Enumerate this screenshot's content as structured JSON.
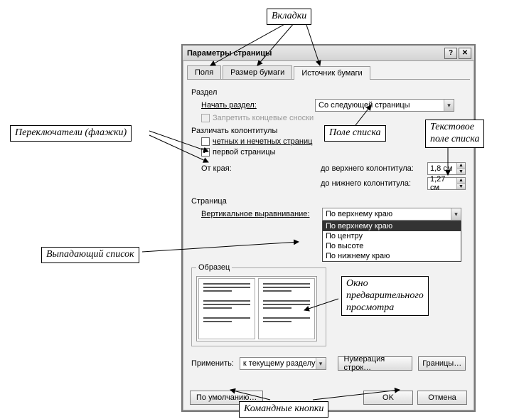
{
  "callouts": {
    "tabs": "Вкладки",
    "switches": "Переключатели (флажки)",
    "listfield": "Поле списка",
    "textlistfield": "Текстовое\nполе списка",
    "dropdown": "Выпадающий список",
    "preview": "Окно\nпредварительного\nпросмотра",
    "buttons": "Командные кнопки"
  },
  "dialog": {
    "title": "Параметры страницы",
    "tabs": {
      "t0": "Поля",
      "t1": "Размер бумаги",
      "t2": "Источник бумаги"
    },
    "section": {
      "label": "Раздел",
      "start_label": "Начать раздел:",
      "start_value": "Со следующей страницы",
      "suppress_endnotes": "Запретить концевые сноски"
    },
    "headers": {
      "label": "Различать колонтитулы",
      "odd_even": "четных и нечетных страниц",
      "first_page": "первой страницы",
      "from_edge": "От края:",
      "header_label": "до верхнего колонтитула:",
      "header_value": "1,8 см",
      "footer_label": "до нижнего колонтитула:",
      "footer_value": "1,27 см"
    },
    "page": {
      "label": "Страница",
      "valign_label": "Вертикальное выравнивание:",
      "valign_value": "По верхнему краю",
      "options": {
        "o0": "По верхнему краю",
        "o1": "По центру",
        "o2": "По высоте",
        "o3": "По нижнему краю"
      }
    },
    "sample": {
      "legend": "Образец"
    },
    "apply": {
      "label": "Применить:",
      "value": "к текущему разделу",
      "line_numbers": "Нумерация строк…",
      "borders": "Границы…"
    },
    "buttons": {
      "default": "По умолчанию…",
      "ok": "OK",
      "cancel": "Отмена"
    }
  }
}
